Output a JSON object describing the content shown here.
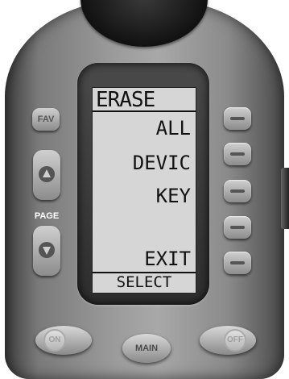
{
  "lcd": {
    "title": "ERASE",
    "items": [
      "ALL",
      "DEVIC",
      "KEY",
      "",
      "EXIT"
    ],
    "footer": "SELECT"
  },
  "buttons": {
    "fav": "FAV",
    "page_label": "PAGE",
    "on": "ON",
    "main": "MAIN",
    "off": "OFF"
  },
  "icons": {
    "page_up": "triangle-up",
    "page_down": "triangle-down",
    "soft_key": "dash"
  },
  "colors": {
    "body": "#9c9c9c",
    "lcd_background": "#d6d6d6",
    "lcd_text": "#111111"
  }
}
